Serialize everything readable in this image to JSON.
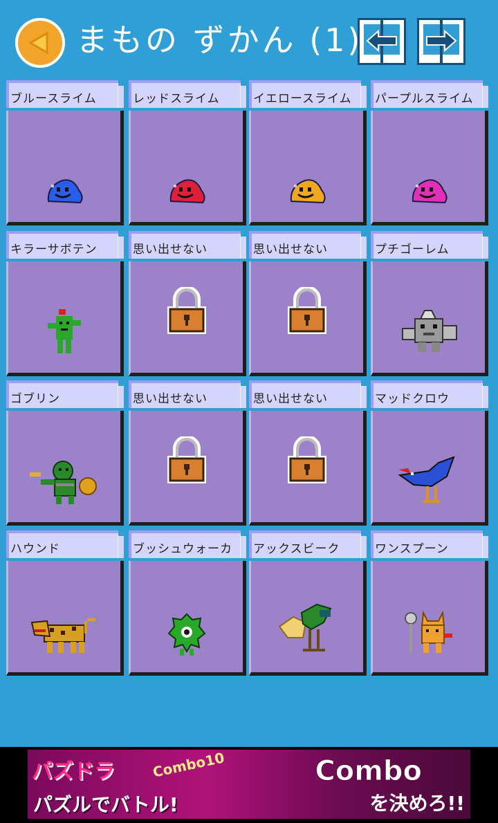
{
  "header": {
    "title": "まもの ずかん (1)"
  },
  "cards": [
    {
      "name": "ブルースライム",
      "sprite": "blue-slime",
      "color": "#2a5ee8",
      "locked": false
    },
    {
      "name": "レッドスライム",
      "sprite": "red-slime",
      "color": "#e0203a",
      "locked": false
    },
    {
      "name": "イエロースライム",
      "sprite": "yellow-slime",
      "color": "#f0a820",
      "locked": false
    },
    {
      "name": "パープルスライム",
      "sprite": "purple-slime",
      "color": "#e030b8",
      "locked": false
    },
    {
      "name": "キラーサボテン",
      "sprite": "killer-cactus",
      "color": "#2aa82a",
      "locked": false
    },
    {
      "name": "思い出せない",
      "sprite": "lock",
      "color": "#d88030",
      "locked": true
    },
    {
      "name": "思い出せない",
      "sprite": "lock",
      "color": "#d88030",
      "locked": true
    },
    {
      "name": "プチゴーレム",
      "sprite": "petit-golem",
      "color": "#9a9a9a",
      "locked": false
    },
    {
      "name": "ゴブリン",
      "sprite": "goblin",
      "color": "#2a8a2a",
      "locked": false
    },
    {
      "name": "思い出せない",
      "sprite": "lock",
      "color": "#d88030",
      "locked": true
    },
    {
      "name": "思い出せない",
      "sprite": "lock",
      "color": "#d88030",
      "locked": true
    },
    {
      "name": "マッドクロウ",
      "sprite": "mad-crow",
      "color": "#2a50d8",
      "locked": false
    },
    {
      "name": "ハウンド",
      "sprite": "hound",
      "color": "#d8a020",
      "locked": false
    },
    {
      "name": "ブッシュウォーカ",
      "sprite": "bush-walker",
      "color": "#2aa82a",
      "locked": false
    },
    {
      "name": "アックスビーク",
      "sprite": "axe-beak",
      "color": "#f0d070",
      "locked": false
    },
    {
      "name": "ワンスプーン",
      "sprite": "one-spoon",
      "color": "#f0a030",
      "locked": false
    }
  ],
  "ad": {
    "logo": "パズドラ",
    "tagline": "パズルでバトル!",
    "combo_text": "Combo",
    "combo_sub": "を決めろ!!",
    "combo_counter": "Combo10"
  }
}
